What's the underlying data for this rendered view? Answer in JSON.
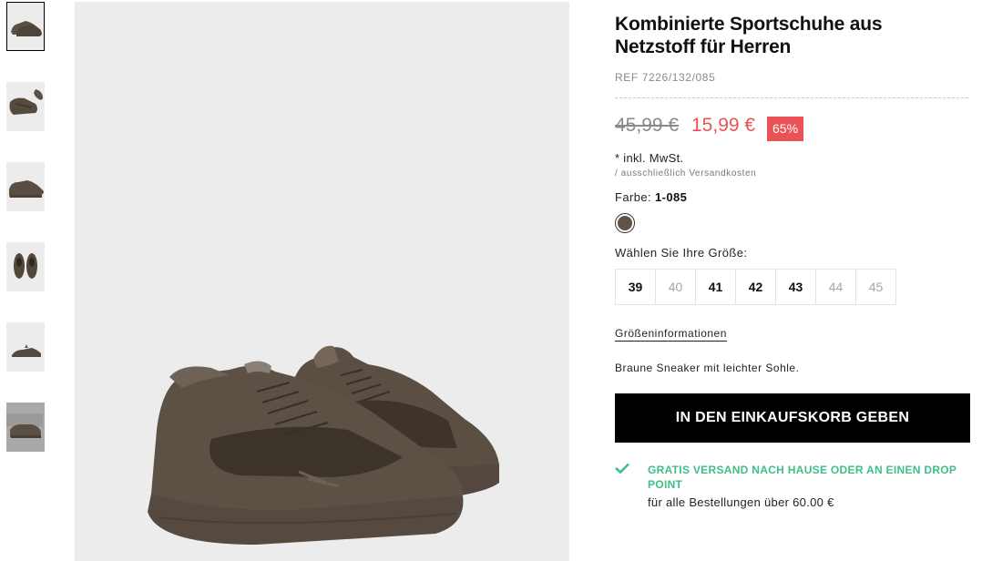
{
  "gallery": {
    "thumbnails": [
      {
        "view": "pair-side",
        "selected": true
      },
      {
        "view": "top-detail",
        "selected": false
      },
      {
        "view": "side",
        "selected": false
      },
      {
        "view": "top",
        "selected": false
      },
      {
        "view": "back",
        "selected": false
      },
      {
        "view": "worn",
        "selected": false
      }
    ],
    "main_view": "pair-three-quarter"
  },
  "product": {
    "title_line1": "Kombinierte Sportschuhe aus",
    "title_line2": "Netzstoff für Herren",
    "ref": "REF 7226/132/085",
    "old_price": "45,99 €",
    "new_price": "15,99 €",
    "discount": "65%",
    "tax": "* inkl. MwSt.",
    "shipping_note": "/ ausschließlich Versandkosten",
    "color_label": "Farbe:",
    "color_value": "1-085",
    "size_label": "Wählen Sie Ihre Größe:",
    "sizes": [
      {
        "label": "39",
        "available": true
      },
      {
        "label": "40",
        "available": false
      },
      {
        "label": "41",
        "available": true
      },
      {
        "label": "42",
        "available": true
      },
      {
        "label": "43",
        "available": true
      },
      {
        "label": "44",
        "available": false
      },
      {
        "label": "45",
        "available": false
      }
    ],
    "size_guide": "Größeninformationen",
    "description": "Braune Sneaker mit leichter Sohle.",
    "add_to_cart": "IN DEN EINKAUFSKORB GEBEN",
    "free_shipping_title": "GRATIS VERSAND NACH HAUSE ODER AN EINEN DROP POINT",
    "free_shipping_sub": "für alle Bestellungen über 60.00 €"
  },
  "colors": {
    "price_red": "#ea5256",
    "success_green": "#3fbe88",
    "shoe_brown": "#615445",
    "button_black": "#000000"
  },
  "icons": {
    "check": "check-icon",
    "swatch": "color-swatch"
  }
}
